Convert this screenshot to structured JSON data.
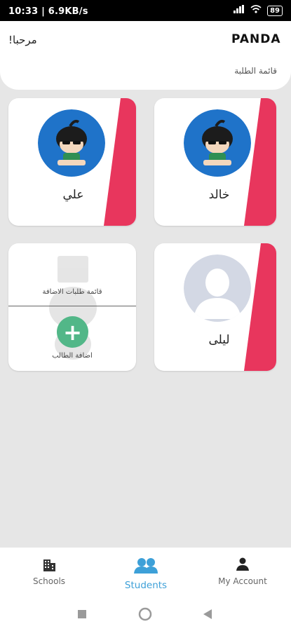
{
  "status_bar": {
    "time_speed": "10:33 | 6.9KB/s",
    "battery": "89"
  },
  "header": {
    "brand": "PANDA",
    "greeting": "مرحبا!",
    "subtitle": "قائمة الطلبة"
  },
  "students": [
    {
      "name": "خالد"
    },
    {
      "name": "علي"
    },
    {
      "name": "ليلى"
    }
  ],
  "add_card": {
    "requests_label": "قائمة طلبات الاضافة",
    "add_label": "اضافة الطالب"
  },
  "nav": {
    "schools": "Schools",
    "students": "Students",
    "account": "My Account"
  },
  "colors": {
    "ribbon": "#e8365d",
    "avatar_bg": "#1f73c9",
    "accent": "#3da0d8",
    "add_button": "#52b788"
  }
}
